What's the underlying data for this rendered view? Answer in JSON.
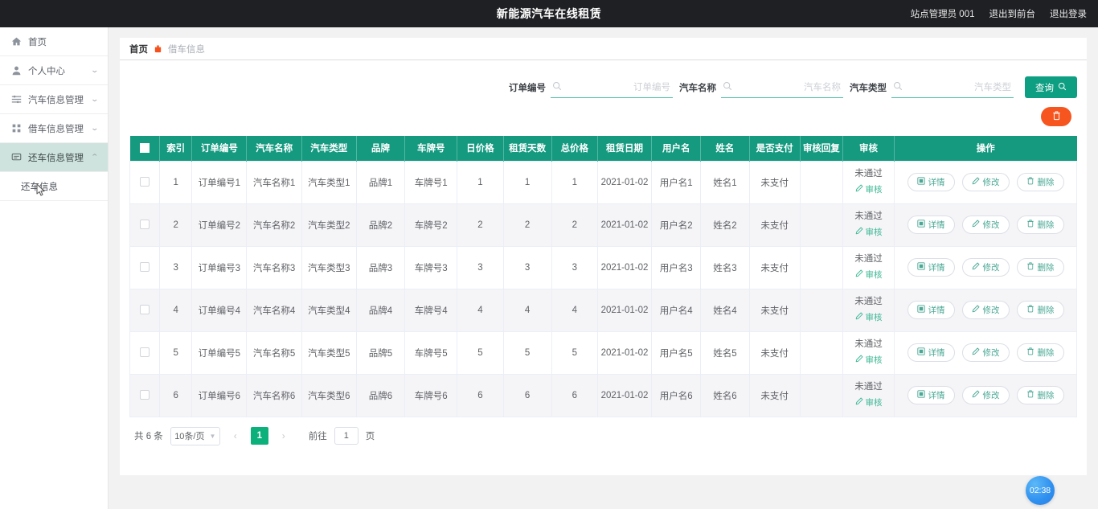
{
  "topbar": {
    "title": "新能源汽车在线租赁",
    "user": "站点管理员 001",
    "exit_front": "退出到前台",
    "logout": "退出登录"
  },
  "sidebar": {
    "items": [
      {
        "label": "首页",
        "icon": "home-icon",
        "expandable": false,
        "active": false
      },
      {
        "label": "个人中心",
        "icon": "user-icon",
        "expandable": true,
        "active": false
      },
      {
        "label": "汽车信息管理",
        "icon": "list-icon",
        "expandable": true,
        "active": false
      },
      {
        "label": "借车信息管理",
        "icon": "grid-icon",
        "expandable": true,
        "active": false
      },
      {
        "label": "还车信息管理",
        "icon": "message-icon",
        "expandable": true,
        "active": true
      }
    ],
    "sub_item": "还车信息"
  },
  "breadcrumb": {
    "home": "首页",
    "current": "借车信息"
  },
  "search": {
    "fields": [
      {
        "label": "订单编号",
        "placeholder": "订单编号",
        "value": ""
      },
      {
        "label": "汽车名称",
        "placeholder": "汽车名称",
        "value": ""
      },
      {
        "label": "汽车类型",
        "placeholder": "汽车类型",
        "value": ""
      }
    ],
    "query_button": "查询",
    "query_icon": "search-icon",
    "delete_all_icon": "trash-icon",
    "accent_color": "#0e9e82",
    "delete_color": "#f6551f"
  },
  "table": {
    "columns": [
      "索引",
      "订单编号",
      "汽车名称",
      "汽车类型",
      "品牌",
      "车牌号",
      "日价格",
      "租赁天数",
      "总价格",
      "租赁日期",
      "用户名",
      "姓名",
      "是否支付",
      "审核回复",
      "审核",
      "操作"
    ],
    "rows": [
      {
        "index": "1",
        "order_no": "订单编号1",
        "car_name": "汽车名称1",
        "car_type": "汽车类型1",
        "brand": "品牌1",
        "plate": "车牌号1",
        "day_price": "1",
        "days": "1",
        "total": "1",
        "date": "2021-01-02",
        "username": "用户名1",
        "name": "姓名1",
        "paid": "未支付",
        "audit_reply": "",
        "audit_status": "未通过"
      },
      {
        "index": "2",
        "order_no": "订单编号2",
        "car_name": "汽车名称2",
        "car_type": "汽车类型2",
        "brand": "品牌2",
        "plate": "车牌号2",
        "day_price": "2",
        "days": "2",
        "total": "2",
        "date": "2021-01-02",
        "username": "用户名2",
        "name": "姓名2",
        "paid": "未支付",
        "audit_reply": "",
        "audit_status": "未通过"
      },
      {
        "index": "3",
        "order_no": "订单编号3",
        "car_name": "汽车名称3",
        "car_type": "汽车类型3",
        "brand": "品牌3",
        "plate": "车牌号3",
        "day_price": "3",
        "days": "3",
        "total": "3",
        "date": "2021-01-02",
        "username": "用户名3",
        "name": "姓名3",
        "paid": "未支付",
        "audit_reply": "",
        "audit_status": "未通过"
      },
      {
        "index": "4",
        "order_no": "订单编号4",
        "car_name": "汽车名称4",
        "car_type": "汽车类型4",
        "brand": "品牌4",
        "plate": "车牌号4",
        "day_price": "4",
        "days": "4",
        "total": "4",
        "date": "2021-01-02",
        "username": "用户名4",
        "name": "姓名4",
        "paid": "未支付",
        "audit_reply": "",
        "audit_status": "未通过"
      },
      {
        "index": "5",
        "order_no": "订单编号5",
        "car_name": "汽车名称5",
        "car_type": "汽车类型5",
        "brand": "品牌5",
        "plate": "车牌号5",
        "day_price": "5",
        "days": "5",
        "total": "5",
        "date": "2021-01-02",
        "username": "用户名5",
        "name": "姓名5",
        "paid": "未支付",
        "audit_reply": "",
        "audit_status": "未通过"
      },
      {
        "index": "6",
        "order_no": "订单编号6",
        "car_name": "汽车名称6",
        "car_type": "汽车类型6",
        "brand": "品牌6",
        "plate": "车牌号6",
        "day_price": "6",
        "days": "6",
        "total": "6",
        "date": "2021-01-02",
        "username": "用户名6",
        "name": "姓名6",
        "paid": "未支付",
        "audit_reply": "",
        "audit_status": "未通过"
      }
    ],
    "audit_link": "审核",
    "ops": [
      {
        "label": "详情",
        "icon": "detail-icon"
      },
      {
        "label": "修改",
        "icon": "edit-icon"
      },
      {
        "label": "删除",
        "icon": "trash-icon"
      }
    ],
    "header_bg": "#159a80"
  },
  "pagination": {
    "total_text": "共 6 条",
    "page_size": "10条/页",
    "prev_icon": "chevron-left-icon",
    "next_icon": "chevron-right-icon",
    "current_page": "1",
    "goto_label": "前往",
    "goto_value": "1",
    "page_unit": "页"
  },
  "timer": {
    "value": "02:38"
  }
}
